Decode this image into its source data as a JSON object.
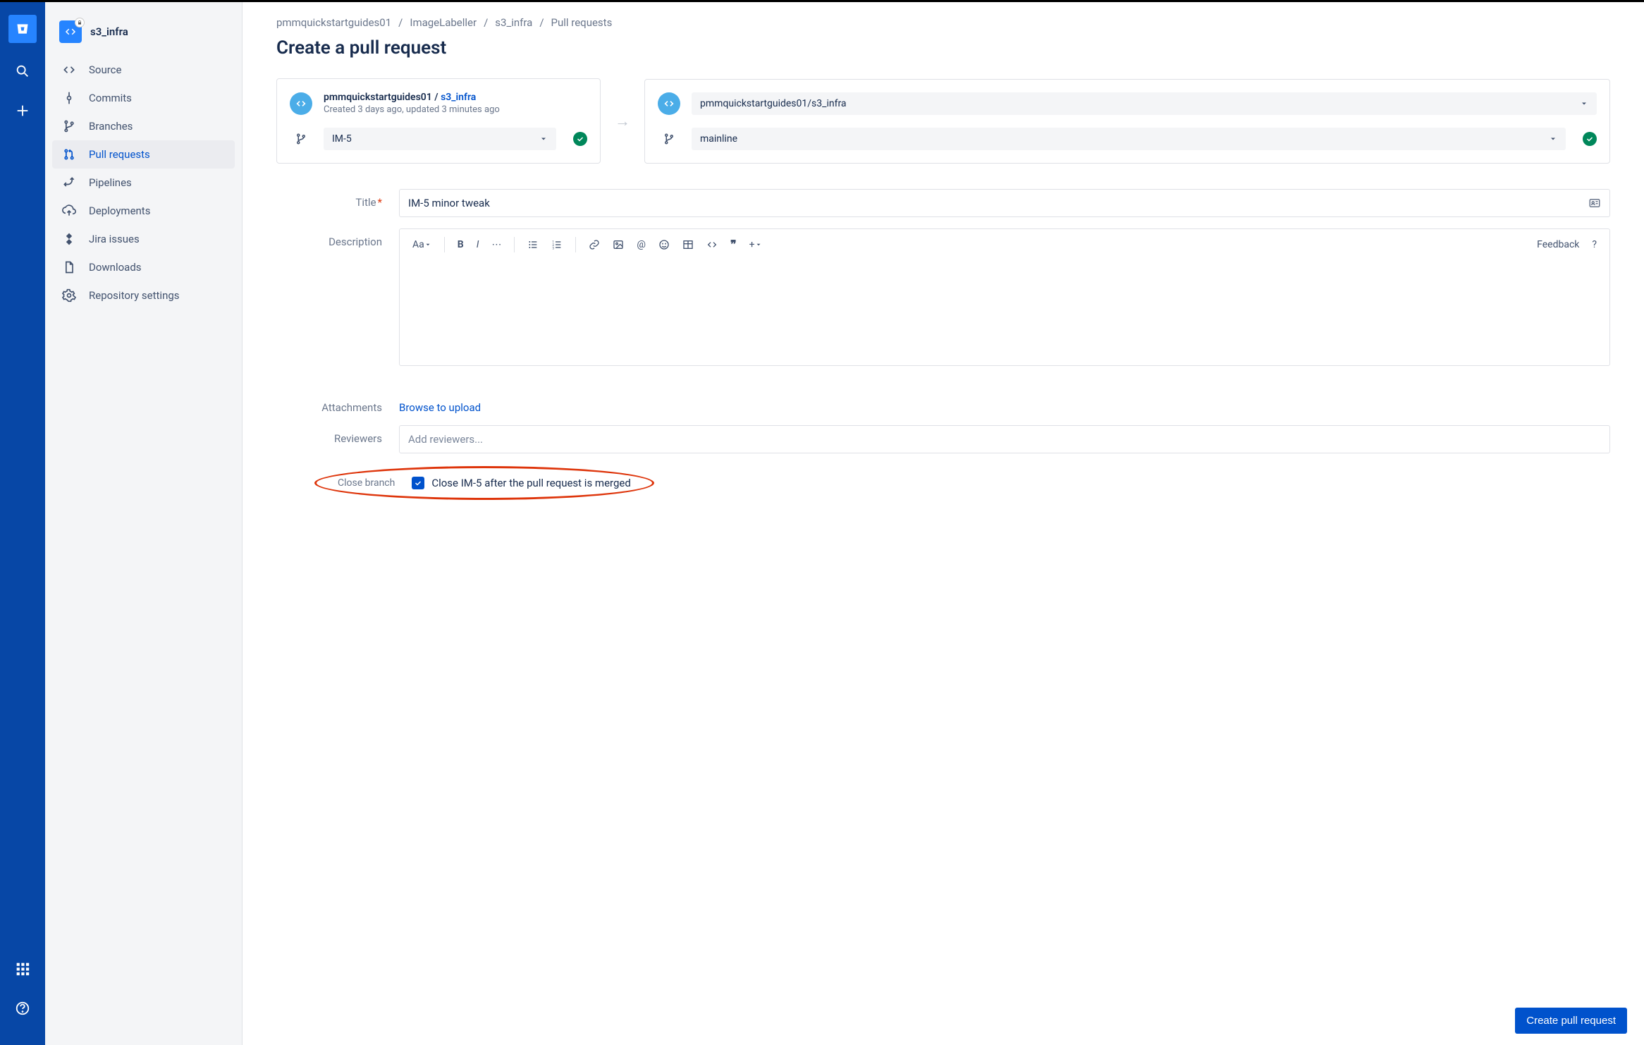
{
  "repo": {
    "name": "s3_infra"
  },
  "nav": {
    "source": "Source",
    "commits": "Commits",
    "branches": "Branches",
    "pull_requests": "Pull requests",
    "pipelines": "Pipelines",
    "deployments": "Deployments",
    "jira": "Jira issues",
    "downloads": "Downloads",
    "settings": "Repository settings"
  },
  "breadcrumbs": {
    "a": "pmmquickstartguides01",
    "b": "ImageLabeller",
    "c": "s3_infra",
    "d": "Pull requests"
  },
  "page_title": "Create a pull request",
  "source": {
    "owner": "pmmquickstartguides01",
    "repo": "s3_infra",
    "meta": "Created 3 days ago, updated 3 minutes ago",
    "branch": "IM-5"
  },
  "dest": {
    "repo_full": "pmmquickstartguides01/s3_infra",
    "branch": "mainline"
  },
  "form": {
    "title_label": "Title",
    "title_value": "IM-5 minor tweak",
    "description_label": "Description",
    "feedback": "Feedback",
    "attachments_label": "Attachments",
    "attachments_link": "Browse to upload",
    "reviewers_label": "Reviewers",
    "reviewers_placeholder": "Add reviewers...",
    "close_label": "Close branch",
    "close_text": "Close IM-5 after the pull request is merged"
  },
  "submit": "Create pull request",
  "toolbar": {
    "text_styles": "Aa"
  }
}
